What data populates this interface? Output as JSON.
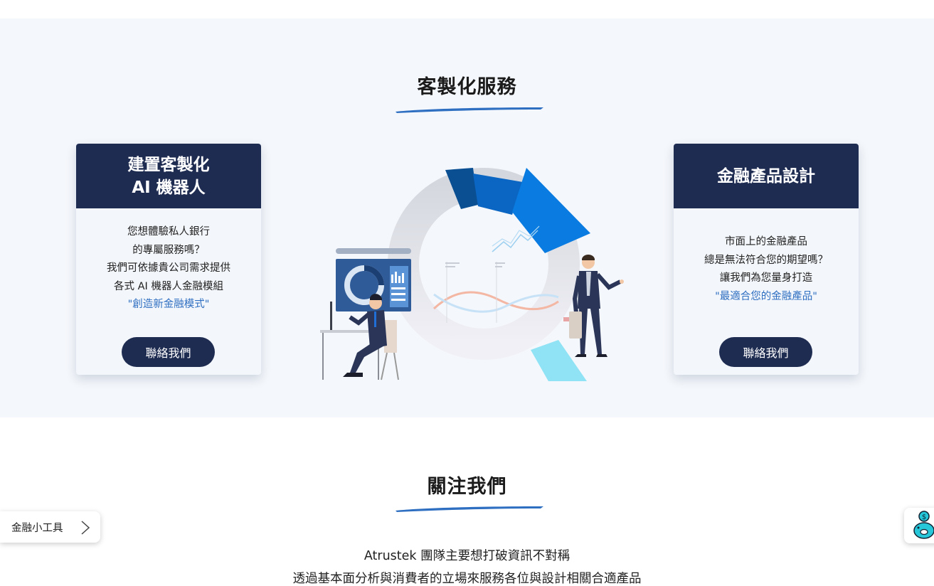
{
  "services": {
    "title": "客製化服務",
    "left_card": {
      "title_line1": "建置客製化",
      "title_line2": "AI 機器人",
      "lines": [
        "您想體驗私人銀行",
        "的專屬服務嗎？",
        "我們可依據貴公司需求提供",
        "各式 AI 機器人金融模組"
      ],
      "highlight": "\"創造新金融模式\"",
      "button_label": "聯絡我們"
    },
    "right_card": {
      "title": "金融產品設計",
      "lines": [
        "市面上的金融產品",
        "總是無法符合您的期望嗎？",
        "讓我們為您量身打造"
      ],
      "highlight": "\"最適合您的金融產品\"",
      "button_label": "聯絡我們"
    }
  },
  "follow": {
    "title": "關注我們",
    "lines": [
      "Atrustek 團隊主要想打破資訊不對稱",
      "透過基本面分析與消費者的立場來服務各位與設計相關合適產品"
    ]
  },
  "floating": {
    "tools_label": "金融小工具",
    "piggy_icon": "piggy-bank-icon"
  },
  "colors": {
    "navy": "#1f2c52",
    "accent_blue": "#2f6fc2",
    "section_bg": "#f4f7fb"
  }
}
